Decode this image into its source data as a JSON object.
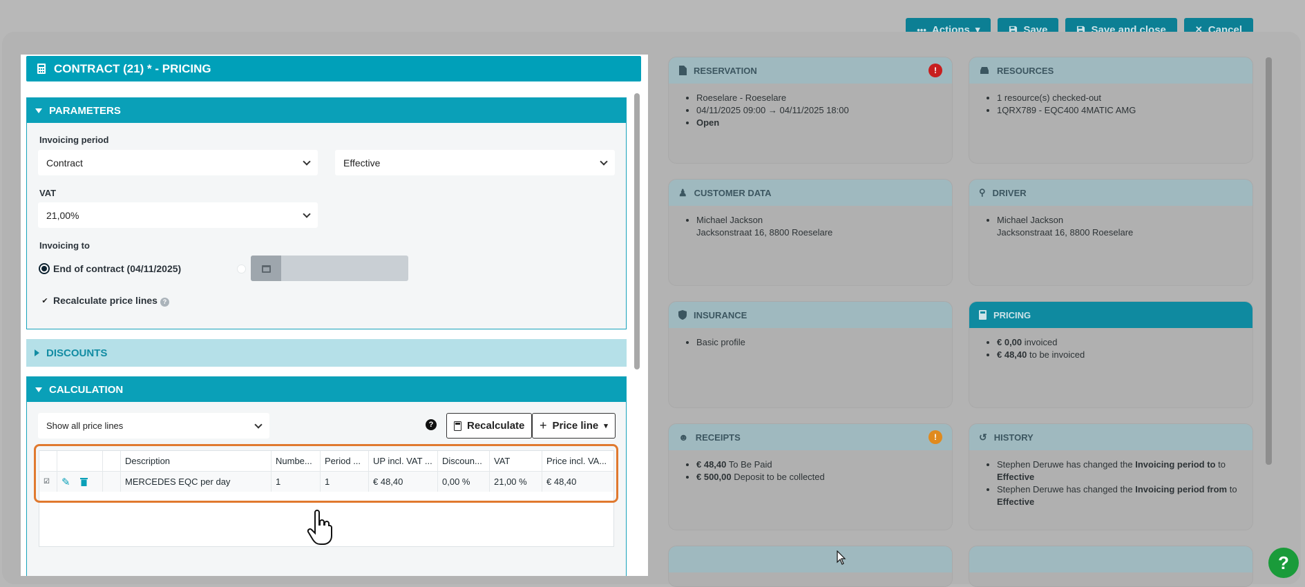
{
  "toolbar": {
    "actions_label": "Actions",
    "save_label": "Save",
    "save_close_label": "Save and close",
    "cancel_label": "Cancel"
  },
  "contract": {
    "title": "CONTRACT (21) * - PRICING"
  },
  "parameters": {
    "title": "PARAMETERS",
    "invoicing_period_label": "Invoicing period",
    "invoicing_period_value": "Contract",
    "period_mode_value": "Effective",
    "vat_label": "VAT",
    "vat_value": "21,00%",
    "invoicing_to_label": "Invoicing to",
    "end_of_contract_label": "End of contract (04/11/2025)",
    "recalculate_label": "Recalculate price lines"
  },
  "discounts": {
    "title": "DISCOUNTS"
  },
  "calculation": {
    "title": "CALCULATION",
    "filter_value": "Show all price lines",
    "recalculate_button": "Recalculate",
    "price_line_button": "Price line",
    "columns": [
      "Description",
      "Numbe...",
      "Period ...",
      "UP incl. VAT ...",
      "Discoun...",
      "VAT",
      "Price incl. VA..."
    ],
    "rows": [
      {
        "description": "MERCEDES EQC per day",
        "number": "1",
        "period": "1",
        "up_incl_vat": "€ 48,40",
        "discount": "0,00 %",
        "vat": "21,00 %",
        "price_incl_vat": "€ 48,40"
      }
    ]
  },
  "cards": {
    "reservation": {
      "title": "RESERVATION",
      "lines": [
        "Roeselare - Roeselare",
        "04/11/2025 09:00 → 04/11/2025 18:00",
        "Open"
      ],
      "badge": "!",
      "badge_color": "#c81e1e"
    },
    "resources": {
      "title": "RESOURCES",
      "lines": [
        "1 resource(s) checked-out",
        "1QRX789 - EQC400 4MATIC AMG"
      ]
    },
    "customer": {
      "title": "CUSTOMER DATA",
      "name": "Michael Jackson",
      "address": "Jacksonstraat 16, 8800 Roeselare"
    },
    "driver": {
      "title": "DRIVER",
      "name": "Michael Jackson",
      "address": "Jacksonstraat 16, 8800 Roeselare"
    },
    "insurance": {
      "title": "INSURANCE",
      "lines": [
        "Basic profile"
      ]
    },
    "pricing": {
      "title": "PRICING",
      "invoiced_amount": "€ 0,00",
      "invoiced_text": "invoiced",
      "to_invoice_amount": "€ 48,40",
      "to_invoice_text": "to be invoiced"
    },
    "receipts": {
      "title": "RECEIPTS",
      "badge": "!",
      "badge_color": "#e08a1e",
      "line1_amount": "€ 48,40",
      "line1_text": "To Be Paid",
      "line2_amount": "€ 500,00",
      "line2_text": "Deposit to be collected"
    },
    "history": {
      "title": "HISTORY",
      "entry1_a": "Stephen Deruwe has changed the",
      "entry1_b": "Invoicing period to",
      "entry1_c": "to",
      "entry1_d": "Effective",
      "entry2_a": "Stephen Deruwe has changed the",
      "entry2_b": "Invoicing period from",
      "entry2_c": "to",
      "entry2_d": "Effective"
    }
  },
  "help_button": "?"
}
